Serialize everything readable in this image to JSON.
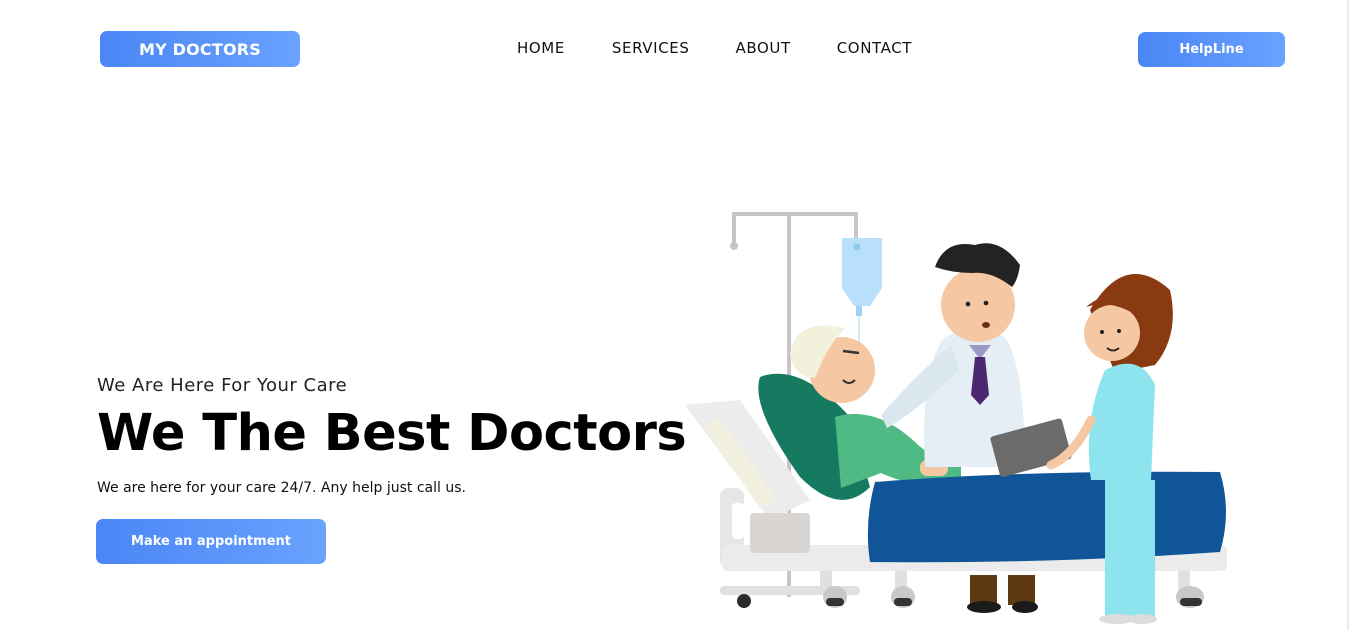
{
  "header": {
    "logo_label": "MY DOCTORS",
    "nav": {
      "home": "HOME",
      "services": "SERVICES",
      "about": "ABOUT",
      "contact": "CONTACT"
    },
    "helpline_label": "HelpLine"
  },
  "hero": {
    "tagline": "We Are Here For Your Care",
    "headline": "We The Best Doctors",
    "subtext": "We are here for your care 24/7. Any help just call us.",
    "cta_label": "Make an appointment"
  },
  "colors": {
    "accent_start": "#4a86f5",
    "accent_end": "#6aa2ff",
    "text": "#111111",
    "background": "#ffffff"
  },
  "illustration": {
    "name": "doctor-nurse-patient-hospital-bed-illustration"
  }
}
